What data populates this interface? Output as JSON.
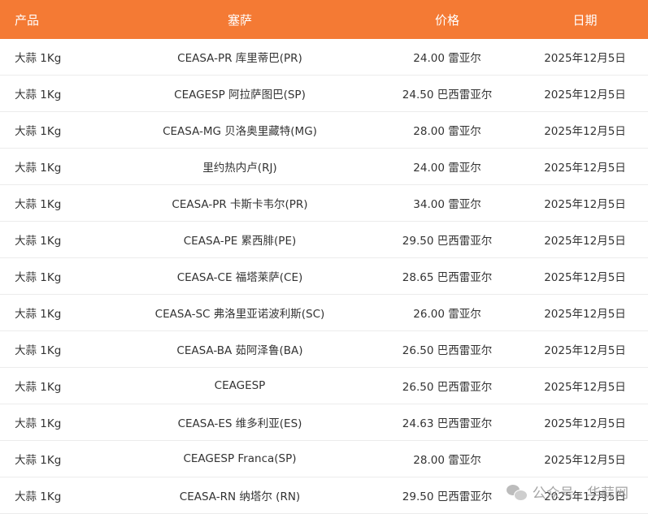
{
  "table": {
    "headers": {
      "product": "产品",
      "market": "塞萨",
      "price": "价格",
      "date": "日期"
    },
    "rows": [
      {
        "product": "大蒜 1Kg",
        "market": "CEASA-PR 库里蒂巴(PR)",
        "price": "24.00 雷亚尔",
        "date": "2025年12月5日"
      },
      {
        "product": "大蒜 1Kg",
        "market": "CEAGESP 阿拉萨图巴(SP)",
        "price": "24.50 巴西雷亚尔",
        "date": "2025年12月5日"
      },
      {
        "product": "大蒜 1Kg",
        "market": "CEASA-MG 贝洛奥里藏特(MG)",
        "price": "28.00 雷亚尔",
        "date": "2025年12月5日"
      },
      {
        "product": "大蒜 1Kg",
        "market": "里约热内卢(RJ)",
        "price": "24.00 雷亚尔",
        "date": "2025年12月5日"
      },
      {
        "product": "大蒜 1Kg",
        "market": "CEASA-PR 卡斯卡韦尔(PR)",
        "price": "34.00 雷亚尔",
        "date": "2025年12月5日"
      },
      {
        "product": "大蒜 1Kg",
        "market": "CEASA-PE 累西腓(PE)",
        "price": "29.50 巴西雷亚尔",
        "date": "2025年12月5日"
      },
      {
        "product": "大蒜 1Kg",
        "market": "CEASA-CE 福塔莱萨(CE)",
        "price": "28.65 巴西雷亚尔",
        "date": "2025年12月5日"
      },
      {
        "product": "大蒜 1Kg",
        "market": "CEASA-SC 弗洛里亚诺波利斯(SC)",
        "price": "26.00 雷亚尔",
        "date": "2025年12月5日"
      },
      {
        "product": "大蒜 1Kg",
        "market": "CEASA-BA 茹阿泽鲁(BA)",
        "price": "26.50 巴西雷亚尔",
        "date": "2025年12月5日"
      },
      {
        "product": "大蒜 1Kg",
        "market": "CEAGESP",
        "price": "26.50 巴西雷亚尔",
        "date": "2025年12月5日"
      },
      {
        "product": "大蒜 1Kg",
        "market": "CEASA-ES 维多利亚(ES)",
        "price": "24.63 巴西雷亚尔",
        "date": "2025年12月5日"
      },
      {
        "product": "大蒜 1Kg",
        "market": "CEAGESP Franca(SP)",
        "price": "28.00 雷亚尔",
        "date": "2025年12月5日"
      },
      {
        "product": "大蒜 1Kg",
        "market": "CEASA-RN 纳塔尔 (RN)",
        "price": "29.50 巴西雷亚尔",
        "date": "2025年12月5日"
      }
    ]
  },
  "watermark": {
    "text": "公众号 · 华蒜网",
    "icon": "wechat-icon"
  },
  "colors": {
    "header_bg": "#f47a34",
    "header_text": "#ffffff",
    "row_text": "#333333"
  }
}
